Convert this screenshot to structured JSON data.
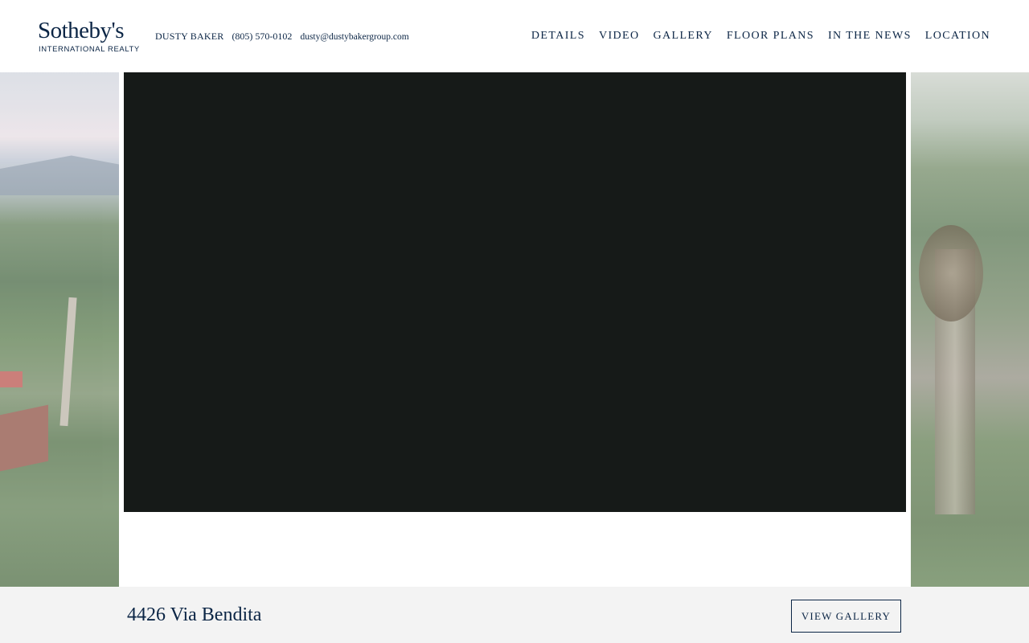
{
  "brand": {
    "name": "Sotheby's",
    "subtitle": "INTERNATIONAL REALTY",
    "color": "#0b2545"
  },
  "contact": {
    "agent": "DUSTY BAKER",
    "phone": "(805) 570-0102",
    "email": "dusty@dustybakergroup.com"
  },
  "nav": {
    "items": [
      {
        "label": "DETAILS"
      },
      {
        "label": "VIDEO"
      },
      {
        "label": "GALLERY"
      },
      {
        "label": "FLOOR PLANS"
      },
      {
        "label": "IN THE NEWS"
      },
      {
        "label": "LOCATION"
      }
    ]
  },
  "video": {
    "background": "#161a18"
  },
  "listing": {
    "address": "4426 Via Bendita",
    "gallery_button": "VIEW GALLERY"
  }
}
